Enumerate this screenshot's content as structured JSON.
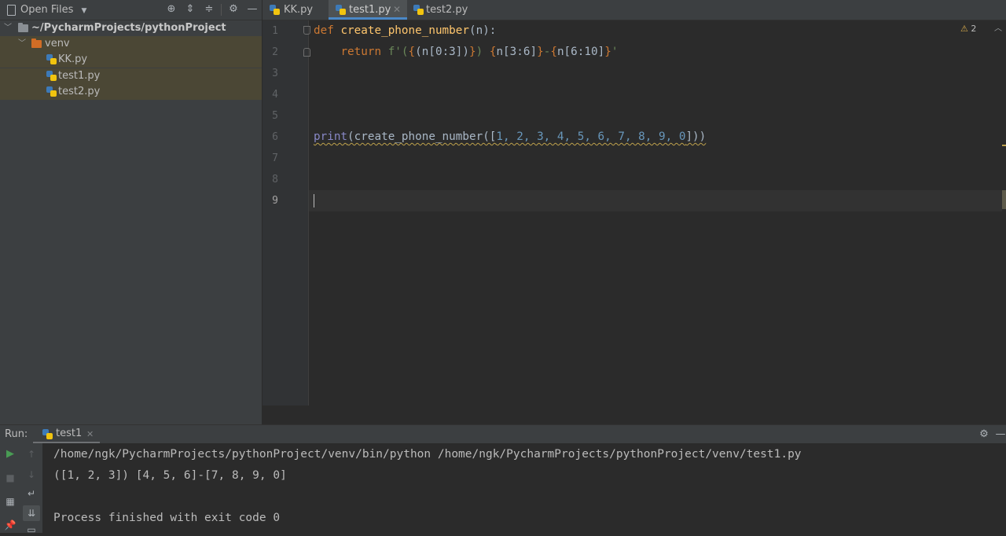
{
  "project_panel": {
    "title": "Open Files",
    "root_label": "~/PycharmProjects/pythonProject",
    "folder_label": "venv",
    "files": [
      "KK.py",
      "test1.py",
      "test2.py"
    ]
  },
  "editor": {
    "tabs": [
      {
        "label": "KK.py",
        "active": false
      },
      {
        "label": "test1.py",
        "active": true
      },
      {
        "label": "test2.py",
        "active": false
      }
    ],
    "line_numbers": [
      "1",
      "2",
      "3",
      "4",
      "5",
      "6",
      "7",
      "8",
      "9"
    ],
    "warnings_count": "2",
    "code": {
      "l1_def": "def",
      "l1_name": "create_phone_number",
      "l1_rest": "(n):",
      "l2_return": "return",
      "l2_fprefix": "f'(",
      "l2_e1_open": "{",
      "l2_e1_expr": "(n[0:3])",
      "l2_e1_close": "}",
      "l2_mid1": ") ",
      "l2_e2_open": "{",
      "l2_e2_expr": "n[3:6]",
      "l2_e2_close": "}",
      "l2_dash": "-",
      "l2_e3_open": "{",
      "l2_e3_expr": "n[6:10]",
      "l2_e3_close": "}",
      "l2_end": "'",
      "l6_print": "print",
      "l6_call": "(create_phone_number([",
      "l6_args": "1, 2, 3, 4, 5, 6, 7, 8, 9, 0",
      "l6_close": "]))"
    }
  },
  "run_panel": {
    "label": "Run:",
    "tab_label": "test1",
    "console_lines": [
      "/home/ngk/PycharmProjects/pythonProject/venv/bin/python /home/ngk/PycharmProjects/pythonProject/venv/test1.py",
      "([1, 2, 3]) [4, 5, 6]-[7, 8, 9, 0]",
      "Process finished with exit code 0"
    ]
  },
  "colors": {
    "accent": "#4a88c7",
    "keyword": "#cc7832",
    "function": "#ffc66d",
    "string": "#6a8759",
    "number": "#6897bb",
    "run_green": "#499c54"
  },
  "icons": [
    "folder-icon",
    "chevron-down-icon",
    "locate-icon",
    "expand-all-icon",
    "collapse-all-icon",
    "gear-icon",
    "minimize-icon",
    "python-file-icon",
    "close-icon",
    "warning-icon",
    "run-icon",
    "stop-icon",
    "up-arrow-icon",
    "down-arrow-icon",
    "soft-wrap-icon",
    "scroll-end-icon",
    "pin-icon",
    "layout-icon",
    "print-icon"
  ]
}
